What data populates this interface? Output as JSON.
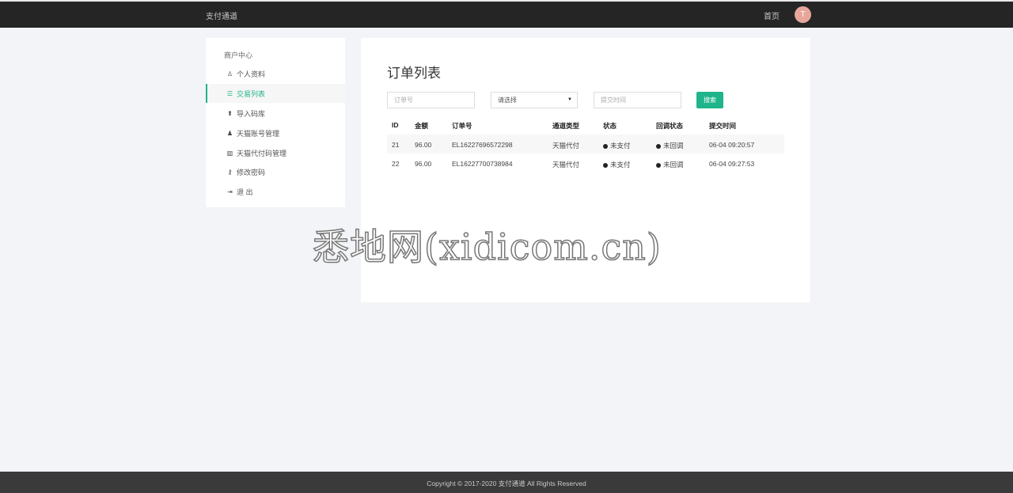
{
  "header": {
    "brand": "支付通道",
    "home_link": "首页",
    "avatar_initial": "T"
  },
  "sidebar": {
    "title": "商户中心",
    "items": [
      {
        "label": "个人资料",
        "icon": "user-icon",
        "glyph": "♙"
      },
      {
        "label": "交易列表",
        "icon": "list-icon",
        "glyph": "☰"
      },
      {
        "label": "导入码库",
        "icon": "user-upload-icon",
        "glyph": "⬆"
      },
      {
        "label": "天猫账号管理",
        "icon": "users-icon",
        "glyph": "♟"
      },
      {
        "label": "天猫代付码管理",
        "icon": "barcode-icon",
        "glyph": "▥"
      },
      {
        "label": "修改密码",
        "icon": "key-icon",
        "glyph": "⚷"
      },
      {
        "label": "退 出",
        "icon": "sign-out-icon",
        "glyph": "⇥"
      }
    ]
  },
  "main": {
    "title": "订单列表",
    "order_placeholder": "订单号",
    "select_value": "请选择",
    "time_placeholder": "提交时间",
    "search_label": "搜索"
  },
  "table": {
    "headers": [
      "ID",
      "金额",
      "订单号",
      "通道类型",
      "状态",
      "回调状态",
      "提交时间"
    ],
    "rows": [
      [
        "21",
        "96.00",
        "EL16227696572298",
        "天猫代付",
        "未支付",
        "未回调",
        "06-04 09:20:57"
      ],
      [
        "22",
        "96.00",
        "EL16227700738984",
        "天猫代付",
        "未支付",
        "未回调",
        "06-04 09:27:53"
      ]
    ]
  },
  "footer": {
    "copyright": "Copyright © 2017-2020 支付通道 All Rights Reserved"
  },
  "watermark": "悉地网(xidicom.cn)"
}
